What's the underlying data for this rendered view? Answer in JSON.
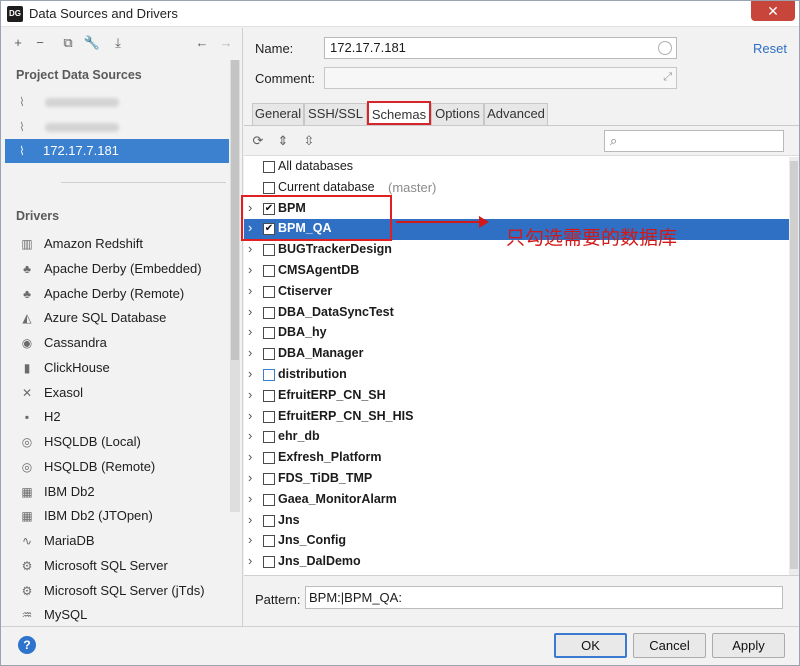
{
  "window": {
    "app_logo": "DG",
    "title": "Data Sources and Drivers",
    "close": "✕"
  },
  "left_toolbar": {
    "icons": [
      "add-icon",
      "minus-icon",
      "duplicate-icon",
      "wrench-icon",
      "import-icon",
      "back-arrow-icon",
      "forward-arrow-icon"
    ]
  },
  "project_data_sources": {
    "heading": "Project Data Sources",
    "items": [
      {
        "label": "",
        "blurred": true
      },
      {
        "label": "",
        "blurred": true
      },
      {
        "label": "172.17.7.181",
        "selected": true
      }
    ]
  },
  "drivers": {
    "heading": "Drivers",
    "items": [
      {
        "label": "Amazon Redshift",
        "icon": "redshift-icon"
      },
      {
        "label": "Apache Derby (Embedded)",
        "icon": "derby-icon"
      },
      {
        "label": "Apache Derby (Remote)",
        "icon": "derby-icon"
      },
      {
        "label": "Azure SQL Database",
        "icon": "azure-icon"
      },
      {
        "label": "Cassandra",
        "icon": "cassandra-icon"
      },
      {
        "label": "ClickHouse",
        "icon": "clickhouse-icon"
      },
      {
        "label": "Exasol",
        "icon": "exasol-icon"
      },
      {
        "label": "H2",
        "icon": "h2-icon"
      },
      {
        "label": "HSQLDB (Local)",
        "icon": "hsqldb-icon"
      },
      {
        "label": "HSQLDB (Remote)",
        "icon": "hsqldb-icon"
      },
      {
        "label": "IBM Db2",
        "icon": "db2-icon"
      },
      {
        "label": "IBM Db2 (JTOpen)",
        "icon": "db2-icon"
      },
      {
        "label": "MariaDB",
        "icon": "mariadb-icon"
      },
      {
        "label": "Microsoft SQL Server",
        "icon": "sqlserver-icon"
      },
      {
        "label": "Microsoft SQL Server (jTds)",
        "icon": "sqlserver-icon"
      },
      {
        "label": "MySQL",
        "icon": "mysql-icon"
      }
    ]
  },
  "form": {
    "name_label": "Name:",
    "name_value": "172.17.7.181",
    "comment_label": "Comment:",
    "comment_value": "",
    "reset_label": "Reset"
  },
  "tabs": [
    {
      "label": "General"
    },
    {
      "label": "SSH/SSL"
    },
    {
      "label": "Schemas",
      "active": true
    },
    {
      "label": "Options"
    },
    {
      "label": "Advanced"
    }
  ],
  "schemas_toolbar": {
    "icons": [
      "refresh-icon",
      "expand-all-icon",
      "collapse-all-icon",
      "search-icon"
    ],
    "search_value": ""
  },
  "schemas": [
    {
      "name": "All databases",
      "checked": false,
      "expandable": false,
      "bold": false
    },
    {
      "name": "Current database",
      "hint": "(master)",
      "checked": false,
      "expandable": false,
      "bold": false
    },
    {
      "name": "BPM",
      "checked": true,
      "expandable": true,
      "bold": true
    },
    {
      "name": "BPM_QA",
      "checked": true,
      "expandable": true,
      "bold": true,
      "selected": true
    },
    {
      "name": "BUGTrackerDesign",
      "checked": false,
      "expandable": true,
      "bold": true
    },
    {
      "name": "CMSAgentDB",
      "checked": false,
      "expandable": true,
      "bold": true
    },
    {
      "name": "Ctiserver",
      "checked": false,
      "expandable": true,
      "bold": true
    },
    {
      "name": "DBA_DataSyncTest",
      "checked": false,
      "expandable": true,
      "bold": true
    },
    {
      "name": "DBA_hy",
      "checked": false,
      "expandable": true,
      "bold": true
    },
    {
      "name": "DBA_Manager",
      "checked": false,
      "expandable": true,
      "bold": true
    },
    {
      "name": "distribution",
      "checked": false,
      "expandable": true,
      "bold": true,
      "blue_box": true
    },
    {
      "name": "EfruitERP_CN_SH",
      "checked": false,
      "expandable": true,
      "bold": true
    },
    {
      "name": "EfruitERP_CN_SH_HIS",
      "checked": false,
      "expandable": true,
      "bold": true
    },
    {
      "name": "ehr_db",
      "checked": false,
      "expandable": true,
      "bold": true
    },
    {
      "name": "Exfresh_Platform",
      "checked": false,
      "expandable": true,
      "bold": true
    },
    {
      "name": "FDS_TiDB_TMP",
      "checked": false,
      "expandable": true,
      "bold": true
    },
    {
      "name": "Gaea_MonitorAlarm",
      "checked": false,
      "expandable": true,
      "bold": true
    },
    {
      "name": "Jns",
      "checked": false,
      "expandable": true,
      "bold": true
    },
    {
      "name": "Jns_Config",
      "checked": false,
      "expandable": true,
      "bold": true
    },
    {
      "name": "Jns_DalDemo",
      "checked": false,
      "expandable": true,
      "bold": true
    }
  ],
  "annotation": {
    "text": "只勾选需要的数据库",
    "color": "#d21919"
  },
  "pattern": {
    "label": "Pattern:",
    "value": "BPM:|BPM_QA:"
  },
  "footer": {
    "help": "?",
    "ok": "OK",
    "cancel": "Cancel",
    "apply": "Apply"
  },
  "colors": {
    "selection": "#2f6fc4",
    "annotation_red": "#e02020",
    "link": "#2f6fc4"
  }
}
